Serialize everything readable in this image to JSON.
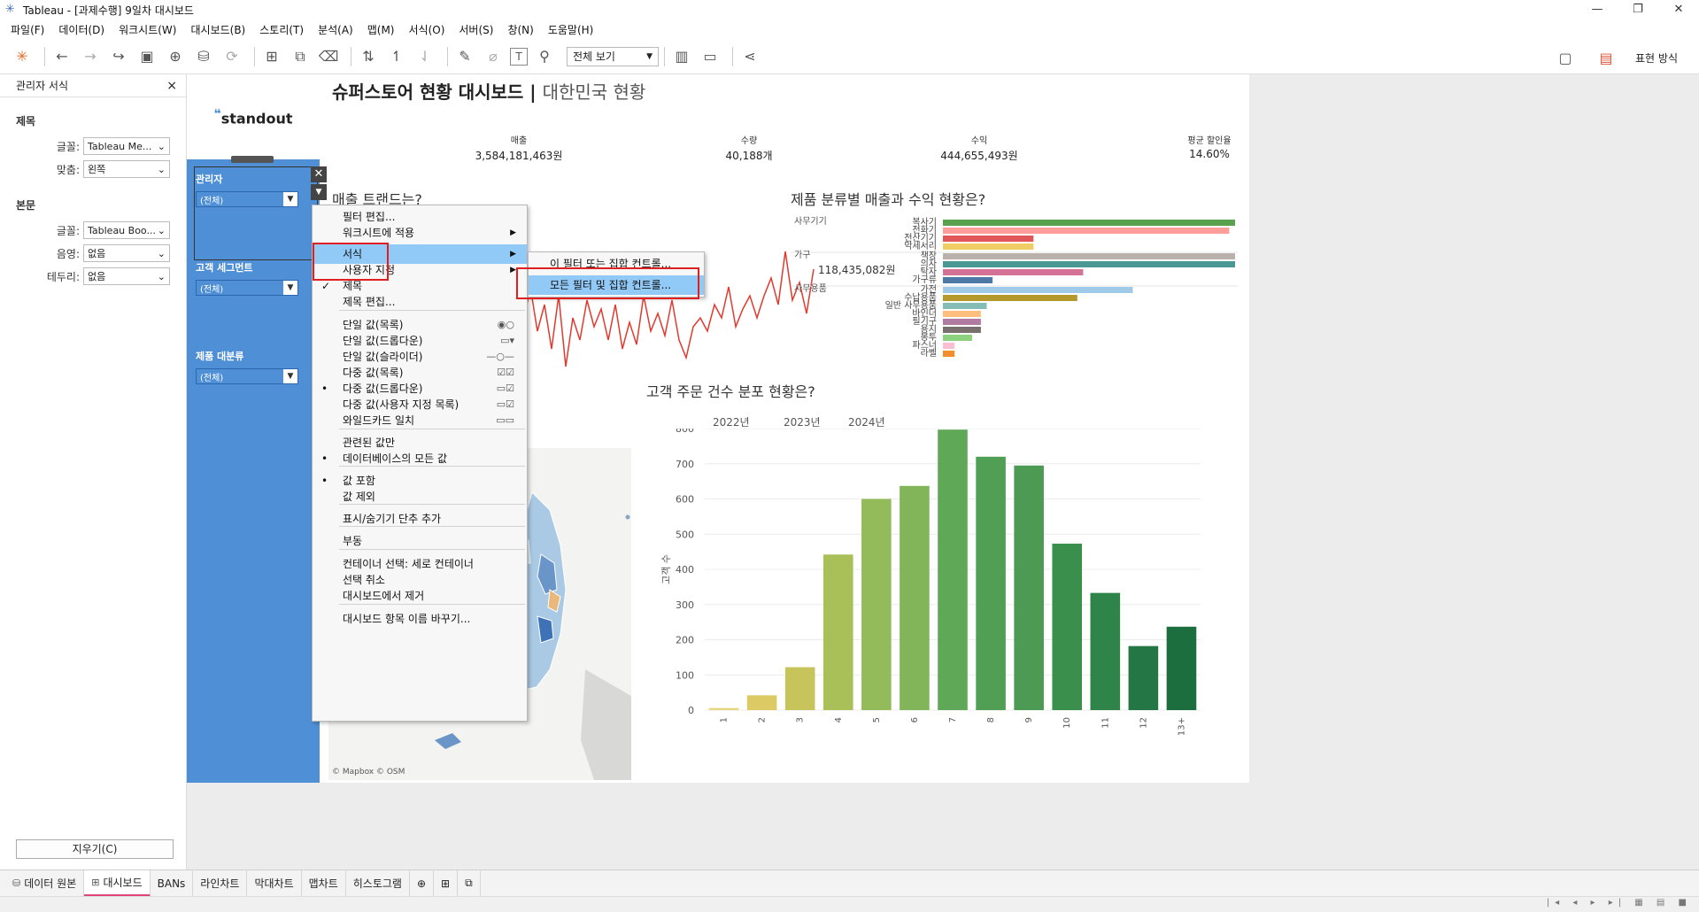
{
  "window": {
    "title": "Tableau - [과제수행] 9일차 대시보드"
  },
  "menubar": [
    "파일(F)",
    "데이터(D)",
    "워크시트(W)",
    "대시보드(B)",
    "스토리(T)",
    "분석(A)",
    "맵(M)",
    "서식(O)",
    "서버(S)",
    "창(N)",
    "도움말(H)"
  ],
  "toolbar": {
    "view_select": "전체 보기",
    "show_me_label": "표현 방식"
  },
  "format_pane": {
    "title": "관리자 서식",
    "section_title": "제목",
    "title_font_label": "글꼴:",
    "title_font_value": "Tableau Me...",
    "title_align_label": "맞춤:",
    "title_align_value": "왼쪽",
    "section_body": "본문",
    "body_font_label": "글꼴:",
    "body_font_value": "Tableau Boo...",
    "shade_label": "음영:",
    "shade_value": "없음",
    "border_label": "테두리:",
    "border_value": "없음",
    "clear_button": "지우기(C)"
  },
  "dashboard": {
    "logo": "standout",
    "title_main": "슈퍼스토어 현황 대시보드 | ",
    "title_sub": "대한민국 현황",
    "filters": [
      {
        "title": "관리자",
        "value": "(전체)"
      },
      {
        "title": "고객 세그먼트",
        "value": "(전체)"
      },
      {
        "title": "제품 대분류",
        "value": "(전체)"
      }
    ],
    "kpis": [
      {
        "label": "매출",
        "value": "3,584,181,463원"
      },
      {
        "label": "수량",
        "value": "40,188개"
      },
      {
        "label": "수익",
        "value": "444,655,493원"
      },
      {
        "label": "평균 할인율",
        "value": "14.60%"
      }
    ],
    "trend_title": "매출 트랜드는?",
    "trend_value_label": "118,435,082원",
    "trend_x_ticks": [
      "2022년",
      "2023년",
      "2024년"
    ],
    "bar_title": "제품 분류별 매출과 수익 현황은?",
    "hist_title": "고객 주문 건수 분포 현황은?",
    "map_credit": "© Mapbox © OSM"
  },
  "product_chart": {
    "type": "bar",
    "groups": [
      {
        "name": "사무기기",
        "items": [
          {
            "label": "복사기",
            "value": 100,
            "color": "#59a14f"
          },
          {
            "label": "전화기",
            "value": 98,
            "color": "#ff9d9a"
          },
          {
            "label": "전산기기",
            "value": 31,
            "color": "#e15759"
          },
          {
            "label": "악세서리",
            "value": 31,
            "color": "#f1ce63"
          }
        ]
      },
      {
        "name": "가구",
        "items": [
          {
            "label": "책장",
            "value": 100,
            "color": "#bab0ac"
          },
          {
            "label": "의자",
            "value": 100,
            "color": "#499894"
          },
          {
            "label": "탁자",
            "value": 48,
            "color": "#d37295"
          },
          {
            "label": "가구류",
            "value": 17,
            "color": "#4e79a7"
          }
        ]
      },
      {
        "name": "사무용품",
        "items": [
          {
            "label": "가전",
            "value": 65,
            "color": "#a0cbe8"
          },
          {
            "label": "수납용품",
            "value": 46,
            "color": "#b6992d"
          },
          {
            "label": "일반 사무용품",
            "value": 15,
            "color": "#86bcb6"
          },
          {
            "label": "바인더",
            "value": 13,
            "color": "#ffbe7d"
          },
          {
            "label": "필기구",
            "value": 13,
            "color": "#b07aa1"
          },
          {
            "label": "용지",
            "value": 13,
            "color": "#79706e"
          },
          {
            "label": "봉투",
            "value": 10,
            "color": "#8cd17d"
          },
          {
            "label": "파스너",
            "value": 4,
            "color": "#fabfd2"
          },
          {
            "label": "라벨",
            "value": 4,
            "color": "#f28e2b"
          }
        ]
      }
    ]
  },
  "chart_data": {
    "type": "bar",
    "categories": [
      "1",
      "2",
      "3",
      "4",
      "5",
      "6",
      "7",
      "8",
      "9",
      "10",
      "11",
      "12",
      "13+"
    ],
    "values": [
      6,
      42,
      122,
      442,
      600,
      637,
      797,
      720,
      695,
      473,
      333,
      182,
      237
    ],
    "ylabel": "고객 수",
    "ylim": [
      0,
      800
    ],
    "yticks": [
      "0",
      "100",
      "200",
      "300",
      "400",
      "500",
      "600",
      "700",
      "800"
    ],
    "colors": [
      "#e8d680",
      "#dccb64",
      "#c6c45a",
      "#a9bf57",
      "#93bb59",
      "#82b55a",
      "#5ea857",
      "#519f55",
      "#4c9a53",
      "#3b8f4d",
      "#2f8449",
      "#247744",
      "#1d6e3f"
    ]
  },
  "context_menu": {
    "items": [
      {
        "label": "필터 편집...",
        "top": 0
      },
      {
        "label": "워크시트에 적용",
        "arrow": true
      },
      {
        "label": "서식",
        "arrow": true,
        "active": true
      },
      {
        "label": "사용자 지정",
        "arrow": true
      },
      {
        "label": "제목",
        "check": true
      },
      {
        "label": "제목 편집..."
      },
      {
        "label": "단일 값(목록)",
        "icon": "◉○"
      },
      {
        "label": "단일 값(드롭다운)",
        "icon": "▭▾"
      },
      {
        "label": "단일 값(슬라이더)",
        "icon": "—○—"
      },
      {
        "label": "다중 값(목록)",
        "icon": "☑☑"
      },
      {
        "label": "다중 값(드롭다운)",
        "dot": true,
        "icon": "▭☑"
      },
      {
        "label": "다중 값(사용자 지정 목록)",
        "icon": "▭☑"
      },
      {
        "label": "와일드카드 일치",
        "icon": "▭▭"
      },
      {
        "label": "관련된 값만"
      },
      {
        "label": "데이터베이스의 모든 값",
        "dot": true
      },
      {
        "label": "값 포함",
        "dot": true
      },
      {
        "label": "값 제외"
      },
      {
        "label": "표시/숨기기 단추 추가"
      },
      {
        "label": "부동"
      },
      {
        "label": "컨테이너 선택: 세로 컨테이너"
      },
      {
        "label": "선택 취소"
      },
      {
        "label": "대시보드에서 제거"
      },
      {
        "label": "대시보드 항목 이름 바꾸기..."
      }
    ],
    "submenu": [
      {
        "label": "이 필터 또는 집합 컨트롤..."
      },
      {
        "label": "모든 필터 및 집합 컨트롤...",
        "active": true
      }
    ]
  },
  "tabs": [
    {
      "label": "데이터 원본",
      "icon": "⛁"
    },
    {
      "label": "대시보드",
      "icon": "⊞",
      "active": true
    },
    {
      "label": "BANs"
    },
    {
      "label": "라인차트"
    },
    {
      "label": "막대차트"
    },
    {
      "label": "맵차트"
    },
    {
      "label": "히스토그램"
    }
  ]
}
